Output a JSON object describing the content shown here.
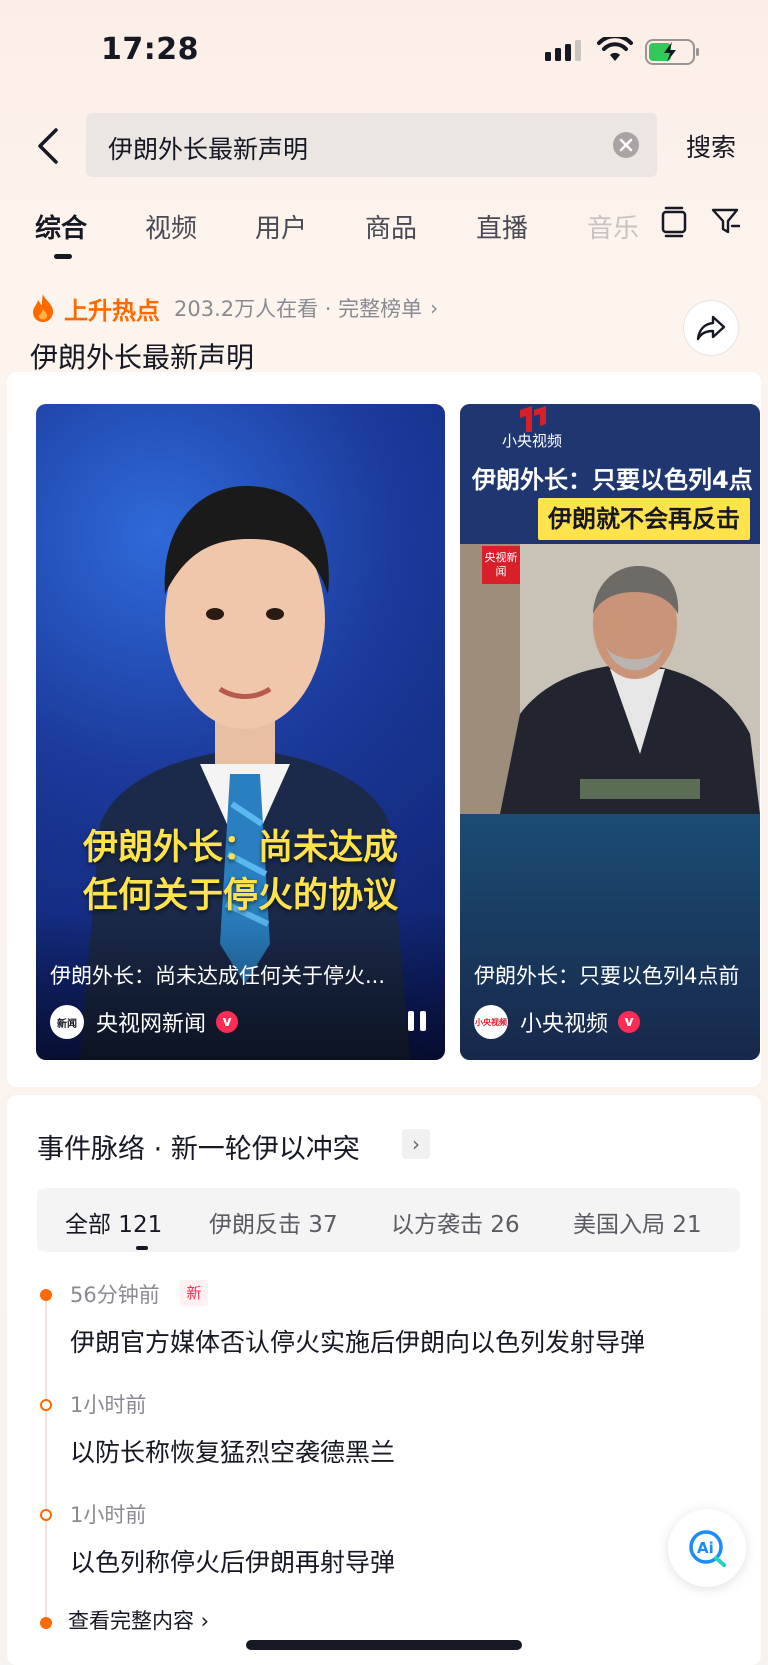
{
  "status_bar": {
    "time": "17:28"
  },
  "search": {
    "query": "伊朗外长最新声明",
    "button_label": "搜索"
  },
  "tabs": [
    {
      "label": "综合"
    },
    {
      "label": "视频"
    },
    {
      "label": "用户"
    },
    {
      "label": "商品"
    },
    {
      "label": "直播"
    },
    {
      "label": "音乐"
    }
  ],
  "hot": {
    "label": "上升热点",
    "meta": "203.2万人在看 · 完整榜单",
    "title": "伊朗外长最新声明"
  },
  "videos": [
    {
      "overlay_line1": "伊朗外长：尚未达成",
      "overlay_line2": "任何关于停火的协议",
      "description": "伊朗外长：尚未达成任何关于停火...",
      "author": "央视网新闻",
      "avatar_text": "新闻"
    },
    {
      "brand": "小央视频",
      "headline1": "伊朗外长：只要以色列4点",
      "headline2": "伊朗就不会再反击",
      "badge": "央视新闻",
      "description": "伊朗外长：只要以色列4点前",
      "author": "小央视频",
      "avatar_text": "小央视频"
    }
  ],
  "event": {
    "title": "事件脉络 · 新一轮伊以冲突",
    "tabs": [
      {
        "label": "全部 121"
      },
      {
        "label": "伊朗反击 37"
      },
      {
        "label": "以方袭击 26"
      },
      {
        "label": "美国入局 21"
      }
    ],
    "items": [
      {
        "time": "56分钟前",
        "badge": "新",
        "text": "伊朗官方媒体否认停火实施后伊朗向以色列发射导弹"
      },
      {
        "time": "1小时前",
        "text": "以防长称恢复猛烈空袭德黑兰"
      },
      {
        "time": "1小时前",
        "text": "以色列称停火后伊朗再射导弹"
      }
    ],
    "more_label": "查看完整内容"
  },
  "colors": {
    "accent": "#fe6a00",
    "verified": "#fe2c55",
    "caption": "#ffe34d"
  },
  "icons": [
    "back-icon",
    "clear-icon",
    "panel-icon",
    "filter-icon",
    "flame-icon",
    "share-icon",
    "pause-icon",
    "verified-icon",
    "ai-icon"
  ]
}
